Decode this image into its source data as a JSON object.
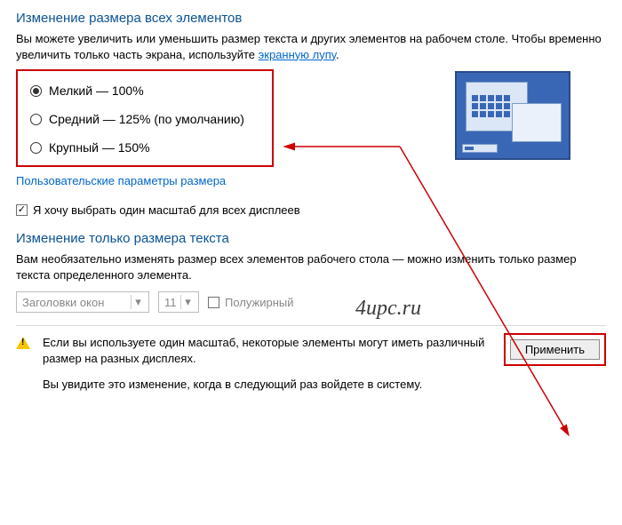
{
  "section1": {
    "title": "Изменение размера всех элементов",
    "desc_before": "Вы можете увеличить или уменьшить размер текста и других элементов на рабочем столе. Чтобы временно увеличить только часть экрана, используйте ",
    "desc_link": "экранную лупу",
    "desc_after": "."
  },
  "scales": {
    "options": [
      {
        "label": "Мелкий — 100%",
        "checked": true
      },
      {
        "label": "Средний — 125% (по умолчанию)",
        "checked": false
      },
      {
        "label": "Крупный — 150%",
        "checked": false
      }
    ],
    "custom_link": "Пользовательские параметры размера"
  },
  "single_scale": {
    "label": "Я хочу выбрать один масштаб для всех дисплеев",
    "checked": true
  },
  "section2": {
    "title": "Изменение только размера текста",
    "desc": "Вам необязательно изменять размер всех элементов рабочего стола — можно изменить только размер текста определенного элемента."
  },
  "controls": {
    "element_select": "Заголовки окон",
    "size_select": "11",
    "bold_label": "Полужирный",
    "bold_checked": false
  },
  "footer": {
    "warn1": "Если вы используете один масштаб, некоторые элементы могут иметь различный размер на разных дисплеях.",
    "warn2": "Вы увидите это изменение, когда в следующий раз войдете в систему.",
    "apply": "Применить"
  },
  "watermark": "4upc.ru"
}
